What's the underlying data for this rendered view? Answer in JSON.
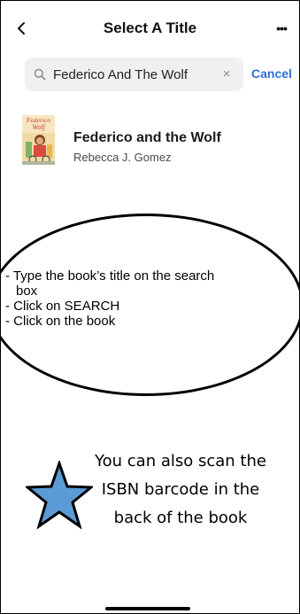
{
  "header": {
    "back_icon": "chevron-left-icon",
    "title": "Select A Title",
    "more_label": "•••",
    "more_icon": "ellipsis-icon"
  },
  "search": {
    "icon": "search-icon",
    "value": "Federico And The Wolf",
    "clear_label": "×",
    "cancel_label": "Cancel"
  },
  "results": [
    {
      "title": "Federico and the Wolf",
      "author": "Rebecca J. Gomez",
      "cover_text": "Federico Wolf"
    }
  ],
  "instructions": [
    "- Type the book’s title on the search",
    "box",
    "- Click on SEARCH",
    "- Click on the book"
  ],
  "scan_note": "You can also scan the ISBN barcode in the back of the book",
  "colors": {
    "accent": "#2f6ed8",
    "search_bg": "#f0f0f1",
    "star_fill": "#5b9bd5",
    "text": "#111111"
  }
}
